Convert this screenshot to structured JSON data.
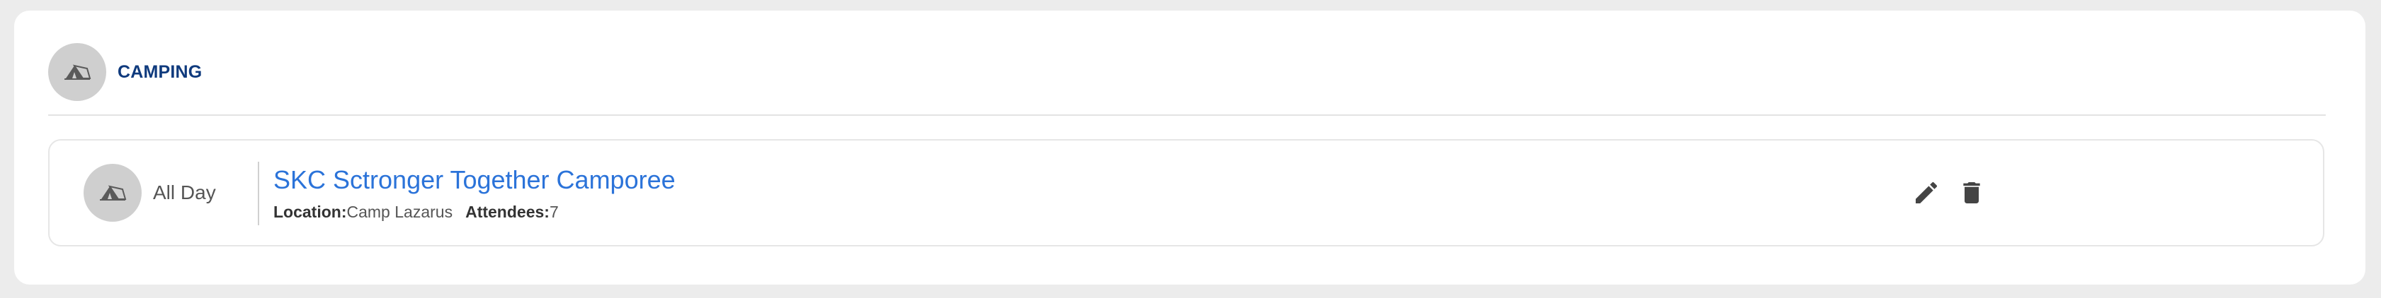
{
  "section": {
    "title": "CAMPING",
    "icon": "tent-icon"
  },
  "event": {
    "icon": "tent-icon",
    "time": "All Day",
    "title": "SKC Sctronger Together Camporee",
    "location_label": "Location:",
    "location": "Camp Lazarus",
    "attendees_label": "Attendees:",
    "attendees": "7",
    "actions": {
      "edit_icon": "pencil-icon",
      "delete_icon": "trash-icon"
    }
  },
  "colors": {
    "background": "#ececec",
    "card": "#ffffff",
    "section_title": "#0f3a7d",
    "event_title": "#2b73d9",
    "avatar": "#cfcfcf",
    "action_icon": "#444444"
  }
}
